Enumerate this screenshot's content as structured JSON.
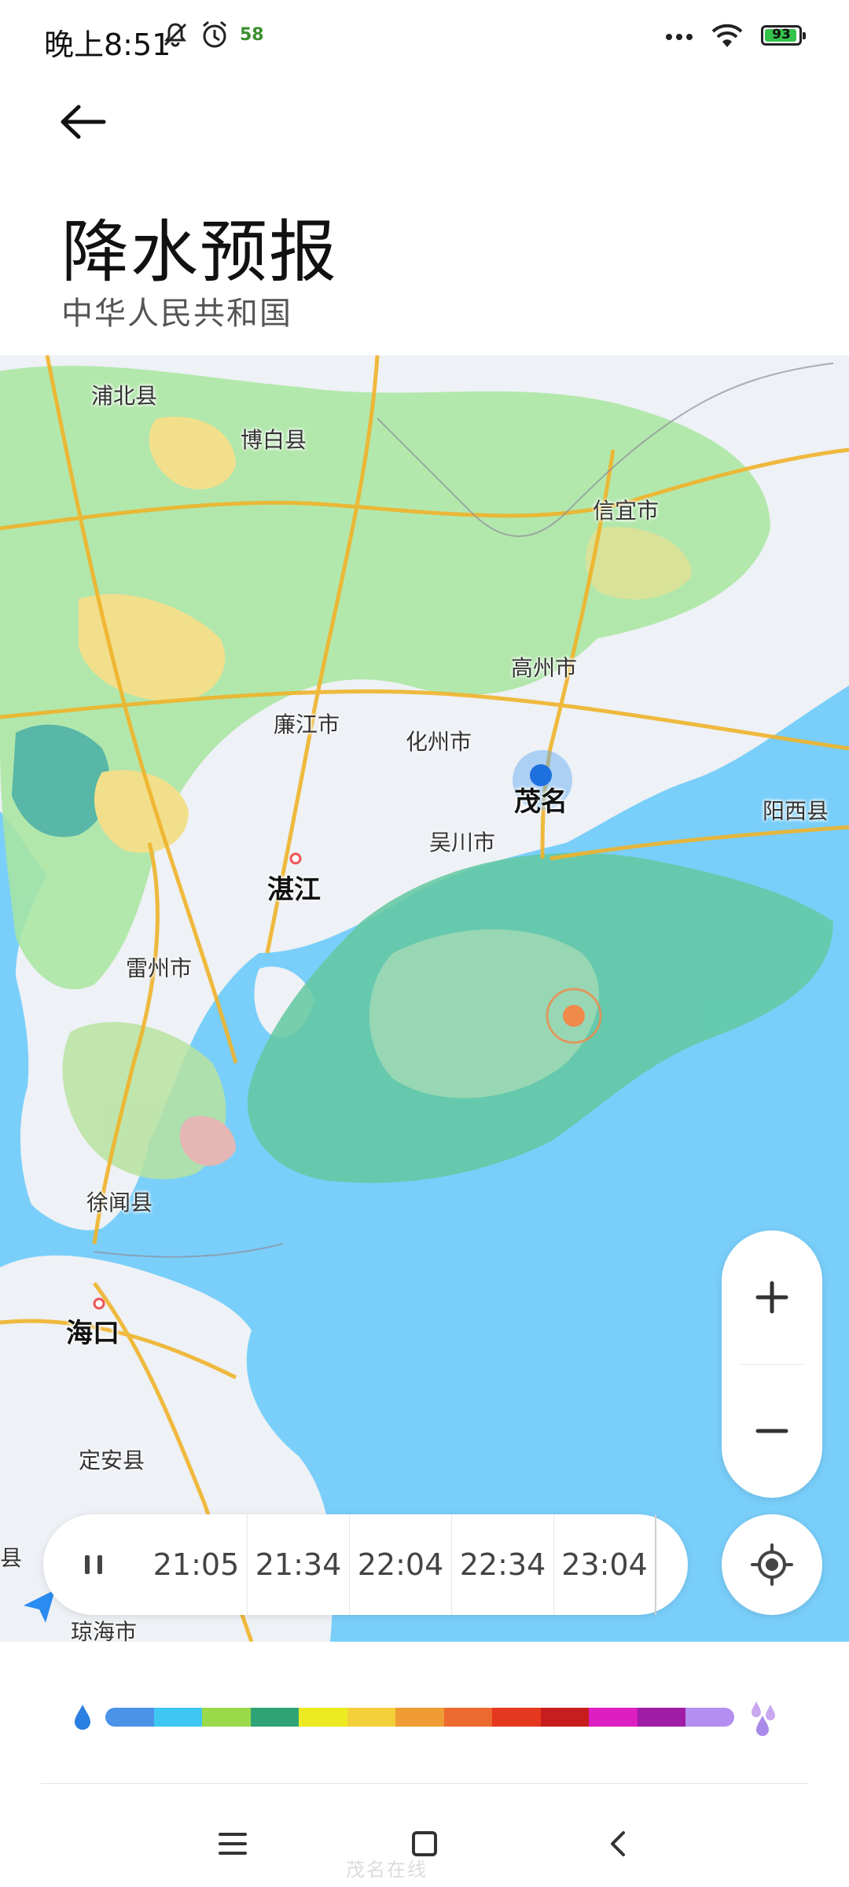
{
  "status_bar": {
    "time": "晚上8:51",
    "badge": "58",
    "battery_percent": "93",
    "icons": [
      "mute-icon",
      "alarm-icon",
      "app-badge-58",
      "more-dots-icon",
      "wifi-icon",
      "battery-icon"
    ]
  },
  "header": {
    "back_icon": "arrow-left-icon",
    "title": "降水预报",
    "subtitle": "中华人民共和国"
  },
  "map": {
    "labels": {
      "pubei": "浦北县",
      "bobai": "博白县",
      "xinyi": "信宜市",
      "gaozhou": "高州市",
      "lianjiang": "廉江市",
      "huazhou": "化州市",
      "maoming": "茂名",
      "yangxi": "阳西县",
      "wuchuan": "吴川市",
      "zhanjiang": "湛江",
      "leizhou": "雷州市",
      "xuwen": "徐闻县",
      "haikou": "海口",
      "dingan": "定安县",
      "qionghai": "琼海市",
      "edge_county": "县"
    },
    "colors": {
      "sea": "#79cffa",
      "land": "#eef1f5",
      "rain_light": "#a8e6a0",
      "rain_teal": "#63c9a0",
      "rain_yellow": "#f3dc7a",
      "road": "#f0b32a"
    }
  },
  "zoom": {
    "in_icon": "plus-icon",
    "out_icon": "minus-icon"
  },
  "locate": {
    "icon": "locate-target-icon"
  },
  "timeline": {
    "pause_icon": "pause-icon",
    "times": [
      "21:05",
      "21:34",
      "22:04",
      "22:34",
      "23:04"
    ]
  },
  "legend": {
    "low_icon": "light-rain-drop-icon",
    "high_icon": "heavy-rain-drops-icon",
    "colors": [
      "#4a93e8",
      "#3ec7f2",
      "#9ad94a",
      "#2fa376",
      "#ecea20",
      "#f3d03a",
      "#ee9c33",
      "#ec6a2f",
      "#e5381f",
      "#c81d1d",
      "#dd1ec1",
      "#a01ba6",
      "#b38ef0"
    ]
  },
  "nav": {
    "menu_icon": "menu-icon",
    "home_icon": "home-square-icon",
    "back_icon": "nav-back-icon"
  },
  "watermark": "茂名在线"
}
